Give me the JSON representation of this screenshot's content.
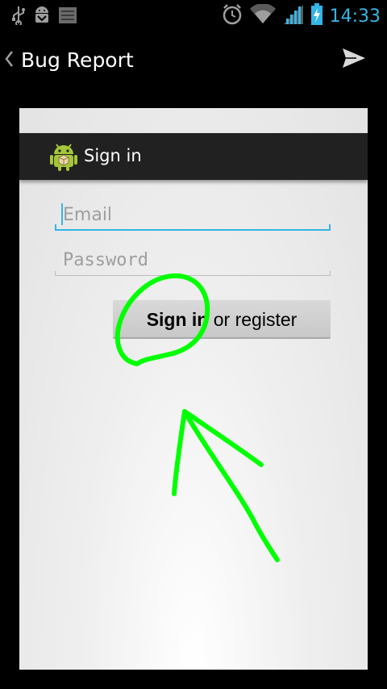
{
  "status_bar": {
    "time": "14:33",
    "left_icons": [
      "usb-icon",
      "android-debug-icon",
      "screenshot-icon"
    ],
    "right_icons": [
      "alarm-icon",
      "wifi-icon",
      "signal-icon",
      "battery-charging-icon"
    ],
    "time_color": "#33b5e5"
  },
  "action_bar": {
    "title": "Bug Report",
    "back_icon": "chevron-left-icon",
    "send_icon": "send-icon"
  },
  "screenshot": {
    "app_bar": {
      "title": "Sign in",
      "icon": "android-icon"
    },
    "email_field": {
      "placeholder": "Email",
      "value": ""
    },
    "password_field": {
      "placeholder": "Password",
      "value": ""
    },
    "sign_in_button": {
      "label_bold": "Sign in",
      "label_rest": " or register"
    },
    "annotation_color": "#00ff00"
  }
}
